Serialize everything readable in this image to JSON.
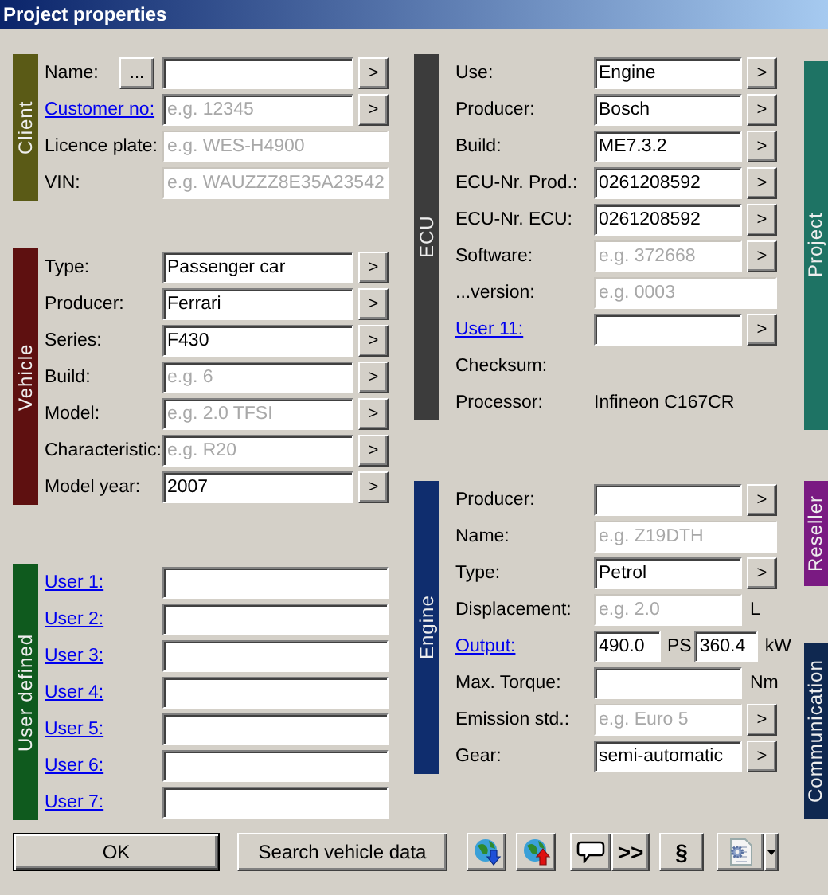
{
  "window": {
    "title": "Project properties"
  },
  "left_sections": [
    {
      "title": "Client",
      "color": "#5a5a16",
      "rows": [
        {
          "kind": "field",
          "label": "Name:",
          "link": false,
          "picker": "...",
          "arrow": ">",
          "disabled": false
        },
        {
          "kind": "field",
          "label": "Customer no:",
          "link": true,
          "placeholder": "e.g. 12345",
          "arrow": ">",
          "disabled": false
        },
        {
          "kind": "field",
          "label": "Licence plate:",
          "link": false,
          "placeholder": "e.g. WES-H4900",
          "disabled": true
        },
        {
          "kind": "field",
          "label": "VIN:",
          "link": false,
          "placeholder": "e.g. WAUZZZ8E35A23542",
          "disabled": true
        }
      ]
    },
    {
      "title": "Vehicle",
      "color": "#5e1010",
      "rows": [
        {
          "kind": "field",
          "label": "Type:",
          "link": false,
          "value": "Passenger car",
          "arrow": ">",
          "disabled": false
        },
        {
          "kind": "field",
          "label": "Producer:",
          "link": false,
          "value": "Ferrari",
          "arrow": ">",
          "disabled": false
        },
        {
          "kind": "field",
          "label": "Series:",
          "link": false,
          "value": "F430",
          "arrow": ">",
          "disabled": false
        },
        {
          "kind": "field",
          "label": "Build:",
          "link": false,
          "placeholder": "e.g. 6",
          "arrow": ">",
          "disabled": false
        },
        {
          "kind": "field",
          "label": "Model:",
          "link": false,
          "placeholder": "e.g. 2.0 TFSI",
          "arrow": ">",
          "disabled": false
        },
        {
          "kind": "field",
          "label": "Characteristic:",
          "link": false,
          "placeholder": "e.g. R20",
          "arrow": ">",
          "disabled": false
        },
        {
          "kind": "field",
          "label": "Model year:",
          "link": false,
          "value": "2007",
          "arrow": ">",
          "disabled": false
        }
      ]
    },
    {
      "title": "User defined",
      "color": "#0f5a1e",
      "rows": [
        {
          "kind": "field",
          "label": "User 1:",
          "link": true,
          "disabled": false
        },
        {
          "kind": "field",
          "label": "User 2:",
          "link": true,
          "disabled": false
        },
        {
          "kind": "field",
          "label": "User 3:",
          "link": true,
          "disabled": false
        },
        {
          "kind": "field",
          "label": "User 4:",
          "link": true,
          "disabled": false
        },
        {
          "kind": "field",
          "label": "User 5:",
          "link": true,
          "disabled": false
        },
        {
          "kind": "field",
          "label": "User 6:",
          "link": true,
          "disabled": false
        },
        {
          "kind": "field",
          "label": "User 7:",
          "link": true,
          "disabled": false
        }
      ]
    }
  ],
  "middle_sections": [
    {
      "title": "ECU",
      "color": "#3c3c3c",
      "rows": [
        {
          "kind": "field",
          "label": "Use:",
          "link": false,
          "value": "Engine",
          "arrow": ">",
          "disabled": false
        },
        {
          "kind": "field",
          "label": "Producer:",
          "link": false,
          "value": "Bosch",
          "arrow": ">",
          "disabled": false
        },
        {
          "kind": "field",
          "label": "Build:",
          "link": false,
          "value": "ME7.3.2",
          "arrow": ">",
          "disabled": false
        },
        {
          "kind": "field",
          "label": "ECU-Nr. Prod.:",
          "link": false,
          "value": "0261208592",
          "arrow": ">",
          "disabled": false
        },
        {
          "kind": "field",
          "label": "ECU-Nr. ECU:",
          "link": false,
          "value": "0261208592",
          "arrow": ">",
          "disabled": false
        },
        {
          "kind": "field",
          "label": "Software:",
          "link": false,
          "placeholder": "e.g. 372668",
          "arrow": ">",
          "disabled": true
        },
        {
          "kind": "field",
          "label": "...version:",
          "link": false,
          "placeholder": "e.g. 0003",
          "disabled": true
        },
        {
          "kind": "field",
          "label": "User 11:",
          "link": true,
          "arrow": ">",
          "disabled": false
        },
        {
          "kind": "label",
          "label": "Checksum:"
        },
        {
          "kind": "text",
          "label": "Processor:",
          "value": "Infineon C167CR"
        }
      ]
    },
    {
      "title": "Engine",
      "color": "#0f2d6e",
      "rows": [
        {
          "kind": "field",
          "label": "Producer:",
          "link": false,
          "arrow": ">",
          "disabled": false
        },
        {
          "kind": "field",
          "label": "Name:",
          "link": false,
          "placeholder": "e.g. Z19DTH",
          "disabled": true
        },
        {
          "kind": "field",
          "label": "Type:",
          "link": false,
          "value": "Petrol",
          "arrow": ">",
          "disabled": false
        },
        {
          "kind": "field",
          "label": "Displacement:",
          "link": false,
          "placeholder": "e.g. 2.0",
          "unit": "L",
          "disabled": true
        },
        {
          "kind": "dual",
          "label": "Output:",
          "link": true,
          "fields": [
            {
              "value": "490.0",
              "unit": "PS"
            },
            {
              "value": "360.4",
              "unit": "kW"
            }
          ]
        },
        {
          "kind": "field",
          "label": "Max. Torque:",
          "link": false,
          "unit": "Nm",
          "disabled": false
        },
        {
          "kind": "field",
          "label": "Emission std.:",
          "link": false,
          "placeholder": "e.g. Euro 5",
          "arrow": ">",
          "disabled": true
        },
        {
          "kind": "field",
          "label": "Gear:",
          "link": false,
          "value": "semi-automatic",
          "arrow": ">",
          "disabled": false
        }
      ]
    }
  ],
  "side_tabs": [
    {
      "title": "Project",
      "color": "#1e7364"
    },
    {
      "title": "Reseller",
      "color": "#7a1a82"
    },
    {
      "title": "Communication",
      "color": "#0f2850"
    }
  ],
  "toolbar": [
    {
      "kind": "text",
      "label": "OK",
      "default": true
    },
    {
      "kind": "text",
      "label": "Search vehicle data",
      "default": false
    },
    {
      "kind": "download"
    },
    {
      "kind": "upload"
    },
    {
      "kind": "comment"
    },
    {
      "kind": "text",
      "label": ">>",
      "default": false
    },
    {
      "kind": "text",
      "label": "§",
      "default": false
    },
    {
      "kind": "document"
    },
    {
      "kind": "dropdown"
    }
  ]
}
